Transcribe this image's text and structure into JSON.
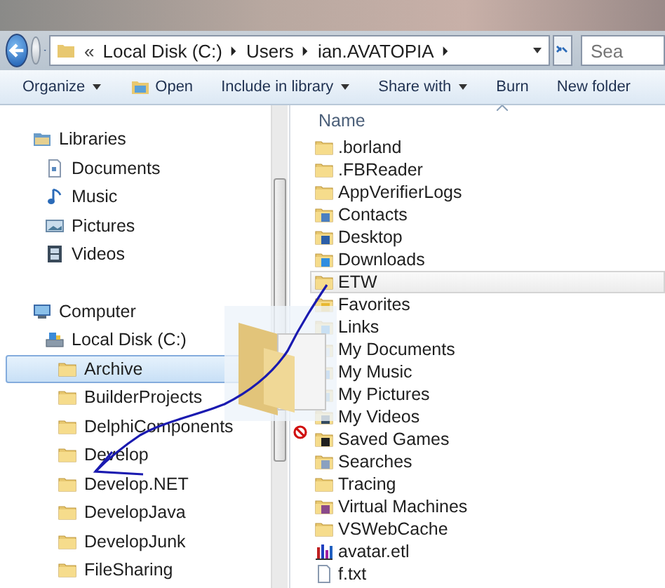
{
  "address_bar": {
    "overflow": "«",
    "crumbs": [
      "Local Disk (C:)",
      "Users",
      "ian.AVATOPIA"
    ]
  },
  "search": {
    "placeholder": "Sea"
  },
  "toolbar": [
    {
      "label": "Organize",
      "dropdown": true,
      "icon": false
    },
    {
      "label": "Open",
      "dropdown": false,
      "icon": true
    },
    {
      "label": "Include in library",
      "dropdown": true,
      "icon": false
    },
    {
      "label": "Share with",
      "dropdown": true,
      "icon": false
    },
    {
      "label": "Burn",
      "dropdown": false,
      "icon": false
    },
    {
      "label": "New folder",
      "dropdown": false,
      "icon": false
    }
  ],
  "navigation": [
    {
      "label": "Libraries",
      "kind": "libraries",
      "selected": false,
      "children": [
        {
          "label": "Documents",
          "kind": "documents",
          "selected": false
        },
        {
          "label": "Music",
          "kind": "music",
          "selected": false
        },
        {
          "label": "Pictures",
          "kind": "pictures",
          "selected": false
        },
        {
          "label": "Videos",
          "kind": "videos",
          "selected": false
        }
      ]
    },
    {
      "label": "Computer",
      "kind": "computer",
      "selected": false,
      "children": [
        {
          "label": "Local Disk (C:)",
          "kind": "drive",
          "selected": false,
          "children": [
            {
              "label": "Archive",
              "kind": "folder",
              "selected": true
            },
            {
              "label": "BuilderProjects",
              "kind": "folder",
              "selected": false
            },
            {
              "label": "DelphiComponents",
              "kind": "folder",
              "selected": false
            },
            {
              "label": "Develop",
              "kind": "folder",
              "selected": false
            },
            {
              "label": "Develop.NET",
              "kind": "folder",
              "selected": false
            },
            {
              "label": "DevelopJava",
              "kind": "folder",
              "selected": false
            },
            {
              "label": "DevelopJunk",
              "kind": "folder",
              "selected": false
            },
            {
              "label": "FileSharing",
              "kind": "folder",
              "selected": false
            }
          ]
        }
      ]
    }
  ],
  "file_list": {
    "column": "Name",
    "items": [
      {
        "name": ".borland",
        "kind": "folder",
        "selected": false
      },
      {
        "name": ".FBReader",
        "kind": "folder",
        "selected": false
      },
      {
        "name": "AppVerifierLogs",
        "kind": "folder",
        "selected": false
      },
      {
        "name": "Contacts",
        "kind": "contacts",
        "selected": false
      },
      {
        "name": "Desktop",
        "kind": "desktop",
        "selected": false
      },
      {
        "name": "Downloads",
        "kind": "downloads",
        "selected": false
      },
      {
        "name": "ETW",
        "kind": "folder",
        "selected": true
      },
      {
        "name": "Favorites",
        "kind": "favorites",
        "selected": false
      },
      {
        "name": "Links",
        "kind": "links",
        "selected": false
      },
      {
        "name": "My Documents",
        "kind": "documents-folder",
        "selected": false
      },
      {
        "name": "My Music",
        "kind": "music-folder",
        "selected": false
      },
      {
        "name": "My Pictures",
        "kind": "pictures-folder",
        "selected": false
      },
      {
        "name": "My Videos",
        "kind": "videos-folder",
        "selected": false
      },
      {
        "name": "Saved Games",
        "kind": "saved-games",
        "selected": false
      },
      {
        "name": "Searches",
        "kind": "searches",
        "selected": false
      },
      {
        "name": "Tracing",
        "kind": "folder",
        "selected": false
      },
      {
        "name": "Virtual Machines",
        "kind": "virtual-machines",
        "selected": false
      },
      {
        "name": "VSWebCache",
        "kind": "folder",
        "selected": false
      },
      {
        "name": "avatar.etl",
        "kind": "chart-file",
        "selected": false
      },
      {
        "name": "f.txt",
        "kind": "text-file",
        "selected": false
      }
    ]
  }
}
